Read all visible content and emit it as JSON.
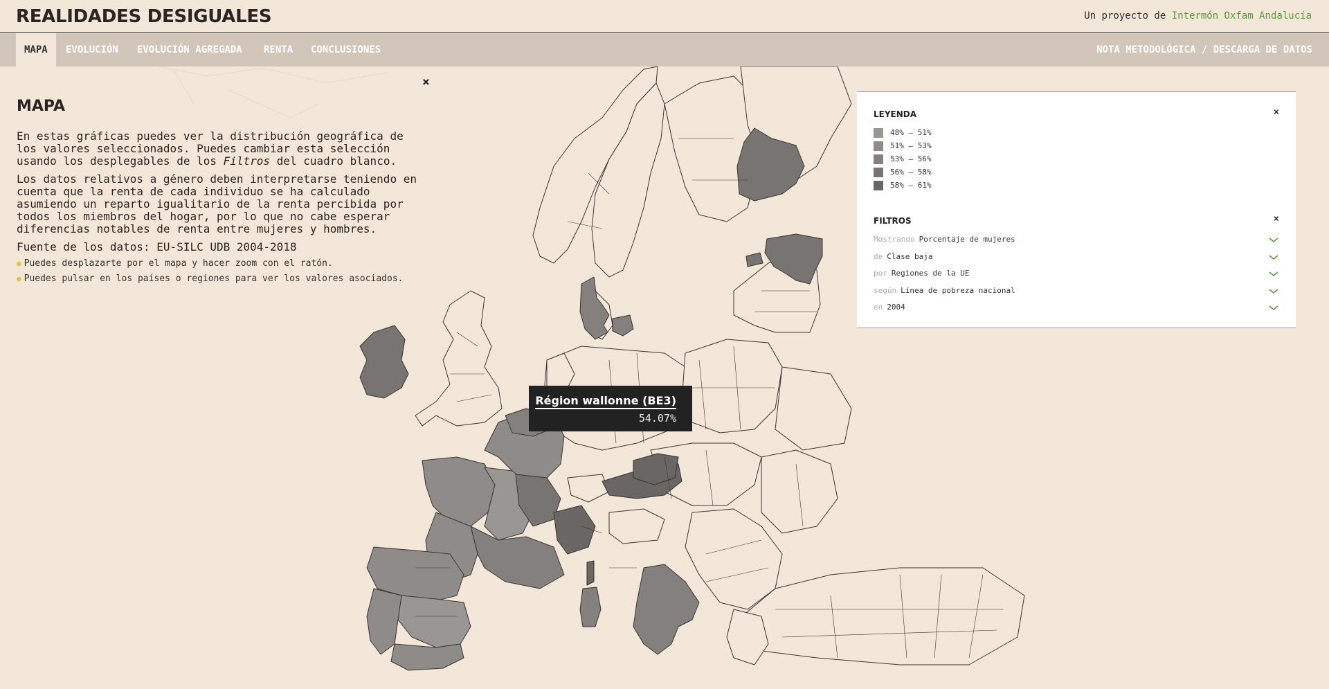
{
  "header": {
    "title": "REALIDADES DESIGUALES",
    "credit_prefix": "Un proyecto de",
    "credit_link": "Intermón Oxfam Andalucía"
  },
  "nav": {
    "items": [
      "MAPA",
      "EVOLUCIÓN",
      "EVOLUCIÓN AGREGADA",
      "RENTA",
      "CONCLUSIONES"
    ],
    "right": "NOTA METODOLÓGICA / DESCARGA DE DATOS"
  },
  "intro": {
    "close": "×",
    "title": "MAPA",
    "p1_a": "En estas gráficas puedes ver la distribución geográfica de los valores seleccionados. Puedes cambiar esta selección usando los desplegables de los ",
    "p1_em": "Filtros",
    "p1_b": " del cuadro blanco.",
    "p2": "Los datos relativos a género deben interpretarse teniendo en cuenta que la renta de cada individuo se ha calculado asumiendo un reparto igualitario de la renta percibida por todos los miembros del hogar, por lo que no cabe esperar diferencias notables de renta entre mujeres y hombres.",
    "source": "Fuente de los datos: EU-SILC UDB 2004-2018",
    "tips": [
      "Puedes desplazarte por el mapa y hacer zoom con el ratón.",
      "Puedes pulsar en los países o regiones para ver los valores asociados."
    ]
  },
  "tooltip": {
    "region": "Région wallonne (BE3)",
    "value": "54.07%"
  },
  "panel": {
    "legend_title": "LEYENDA",
    "legend": [
      {
        "label": "48% – 51%",
        "color": "#9a9693"
      },
      {
        "label": "51% – 53%",
        "color": "#8f8b88"
      },
      {
        "label": "53% – 56%",
        "color": "#84807d"
      },
      {
        "label": "56% – 58%",
        "color": "#787472"
      },
      {
        "label": "58% – 61%",
        "color": "#6a6664"
      }
    ],
    "filters_title": "FILTROS",
    "filters": [
      {
        "key": "Mostrando",
        "value": "Porcentaje de mujeres"
      },
      {
        "key": "de",
        "value": "Clase baja"
      },
      {
        "key": "por",
        "value": "Regiones de la UE"
      },
      {
        "key": "según",
        "value": "Línea de pobreza nacional"
      },
      {
        "key": "en",
        "value": "2004"
      }
    ]
  },
  "colors": {
    "background": "#f3e7da",
    "nav": "#d1c6b9",
    "accent_link": "#5a9a3a",
    "tooltip_bg": "#222222"
  }
}
